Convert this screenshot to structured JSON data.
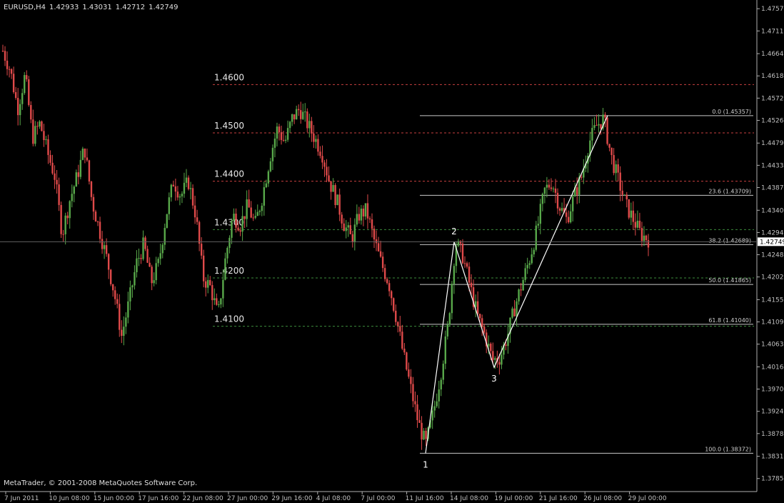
{
  "header": {
    "symbol": "EURUSD,H4",
    "open": "1.42933",
    "high": "1.43031",
    "low": "1.42712",
    "close": "1.42749"
  },
  "copyright": "MetaTrader, © 2001-2008 MetaQuotes Software Corp.",
  "colors": {
    "background": "#000000",
    "axis": "#b0b0b0",
    "bull": "#58a84a",
    "bear": "#e04a4a",
    "line": "#ffffff",
    "red_level": "#c84040",
    "green_level": "#3c8c3c",
    "fib": "#c8c8c8",
    "price_box_bg": "#ffffff",
    "price_box_fg": "#000000"
  },
  "chart_data": {
    "type": "candlestick",
    "title": "EURUSD,H4",
    "ylim": [
      1.3758,
      1.4775
    ],
    "y_ticks": [
      "1.47570",
      "1.47110",
      "1.46640",
      "1.46180",
      "1.45720",
      "1.45260",
      "1.44790",
      "1.44330",
      "1.43870",
      "1.43400",
      "1.42940",
      "1.42480",
      "1.42020",
      "1.41550",
      "1.41090",
      "1.40630",
      "1.40160",
      "1.39700",
      "1.39240",
      "1.38780",
      "1.38310",
      "1.37850"
    ],
    "x_ticks": [
      "7 Jun 2011",
      "10 Jun 08:00",
      "15 Jun 00:00",
      "17 Jun 16:00",
      "22 Jun 08:00",
      "27 Jun 00:00",
      "29 Jun 16:00",
      "4 Jul 08:00",
      "7 Jul 00:00",
      "11 Jul 16:00",
      "14 Jul 08:00",
      "19 Jul 00:00",
      "21 Jul 16:00",
      "26 Jul 08:00",
      "29 Jul 00:00"
    ],
    "current_price": "1.42749",
    "price_path": [
      1.467,
      1.463,
      1.455,
      1.462,
      1.449,
      1.452,
      1.446,
      1.441,
      1.429,
      1.436,
      1.441,
      1.447,
      1.436,
      1.43,
      1.424,
      1.417,
      1.408,
      1.415,
      1.423,
      1.427,
      1.419,
      1.423,
      1.433,
      1.44,
      1.437,
      1.44,
      1.433,
      1.42,
      1.418,
      1.412,
      1.424,
      1.433,
      1.431,
      1.435,
      1.431,
      1.437,
      1.445,
      1.451,
      1.448,
      1.453,
      1.455,
      1.452,
      1.449,
      1.446,
      1.44,
      1.436,
      1.431,
      1.428,
      1.433,
      1.434,
      1.428,
      1.423,
      1.419,
      1.412,
      1.404,
      1.397,
      1.39,
      1.3855,
      1.392,
      1.4,
      1.41,
      1.4275,
      1.4245,
      1.418,
      1.412,
      1.408,
      1.403,
      1.4035,
      1.408,
      1.414,
      1.419,
      1.424,
      1.43,
      1.438,
      1.44,
      1.435,
      1.432,
      1.437,
      1.441,
      1.448,
      1.4515,
      1.453,
      1.445,
      1.44,
      1.435,
      1.432,
      1.429,
      1.428
    ],
    "price_levels": [
      {
        "label": "1.4600",
        "value": 1.46,
        "color": "red"
      },
      {
        "label": "1.4500",
        "value": 1.45,
        "color": "red"
      },
      {
        "label": "1.4400",
        "value": 1.44,
        "color": "red"
      },
      {
        "label": "1.4300",
        "value": 1.43,
        "color": "green"
      },
      {
        "label": "1.4200",
        "value": 1.42,
        "color": "green"
      },
      {
        "label": "1.4100",
        "value": 1.41,
        "color": "green"
      }
    ],
    "fibonacci": [
      {
        "label": "0.0 (1.45357)",
        "value": 1.45357
      },
      {
        "label": "23.6 (1.43709)",
        "value": 1.43709
      },
      {
        "label": "38.2 (1.42689)",
        "value": 1.42689
      },
      {
        "label": "50.0 (1.41865)",
        "value": 1.41865
      },
      {
        "label": "61.8 (1.41040)",
        "value": 1.4104
      },
      {
        "label": "100.0 (1.38372)",
        "value": 1.38372
      }
    ],
    "wave_points": [
      {
        "label": "1",
        "value": 1.3837
      },
      {
        "label": "2",
        "value": 1.4275
      },
      {
        "label": "3",
        "value": 1.4015
      },
      {
        "label": "",
        "value": 1.4536
      }
    ]
  }
}
